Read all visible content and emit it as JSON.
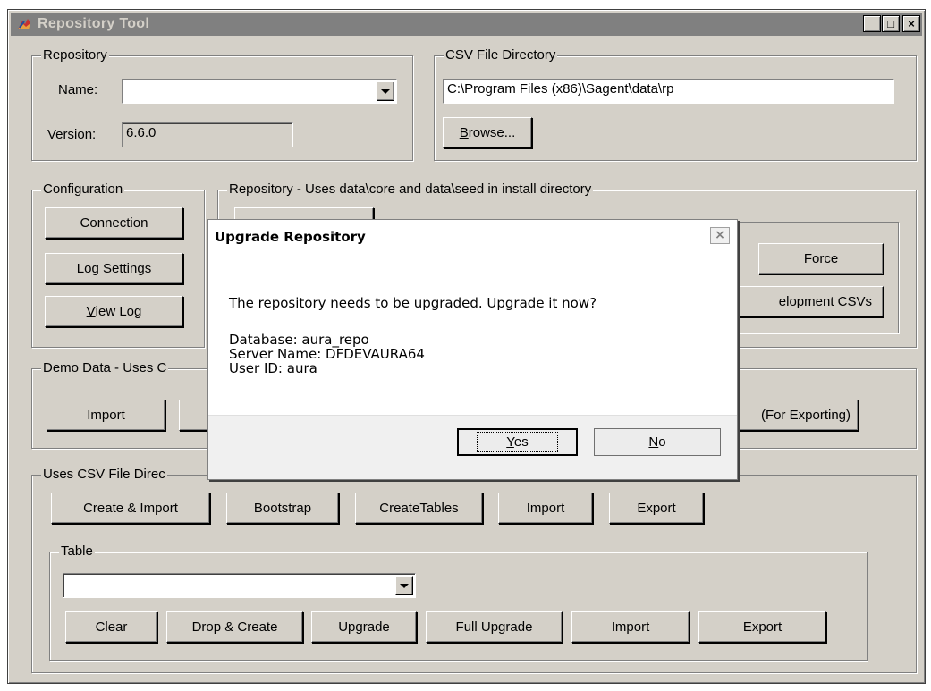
{
  "window": {
    "title": "Repository Tool",
    "controls": {
      "minimize": "_",
      "maximize": "□",
      "close": "×"
    }
  },
  "repository": {
    "legend": "Repository",
    "name_label": "Name:",
    "name_value": "",
    "version_label": "Version:",
    "version_value": "6.6.0"
  },
  "csv_dir": {
    "legend": "CSV File Directory",
    "path": "C:\\Program Files (x86)\\Sagent\\data\\rp",
    "browse_pre": "B",
    "browse_post": "rowse..."
  },
  "configuration": {
    "legend": "Configuration",
    "connection": "Connection",
    "log_settings": "Log Settings",
    "view_log_pre": "V",
    "view_log_post": "iew Log"
  },
  "repo_install": {
    "legend": "Repository - Uses data\\core and data\\seed in install directory",
    "force": "Force",
    "dev_csvs": "elopment CSVs"
  },
  "demo": {
    "legend": "Demo Data - Uses C",
    "import": "Import",
    "for_exporting": "(For Exporting)"
  },
  "uses_csv": {
    "legend": "Uses CSV File Direc",
    "buttons": [
      "Create & Import",
      "Bootstrap",
      "CreateTables",
      "Import",
      "Export"
    ]
  },
  "table": {
    "legend": "Table",
    "selected": "",
    "buttons": [
      "Clear",
      "Drop & Create",
      "Upgrade",
      "Full Upgrade",
      "Import",
      "Export"
    ]
  },
  "dialog": {
    "title": "Upgrade Repository",
    "close": "×",
    "message": "The repository needs to be upgraded.  Upgrade it now?",
    "database": "Database:  aura_repo",
    "server": "Server Name:  DFDEVAURA64",
    "user": "User ID:  aura",
    "yes_pre": "Y",
    "yes_post": "es",
    "no_pre": "N",
    "no_post": "o"
  }
}
